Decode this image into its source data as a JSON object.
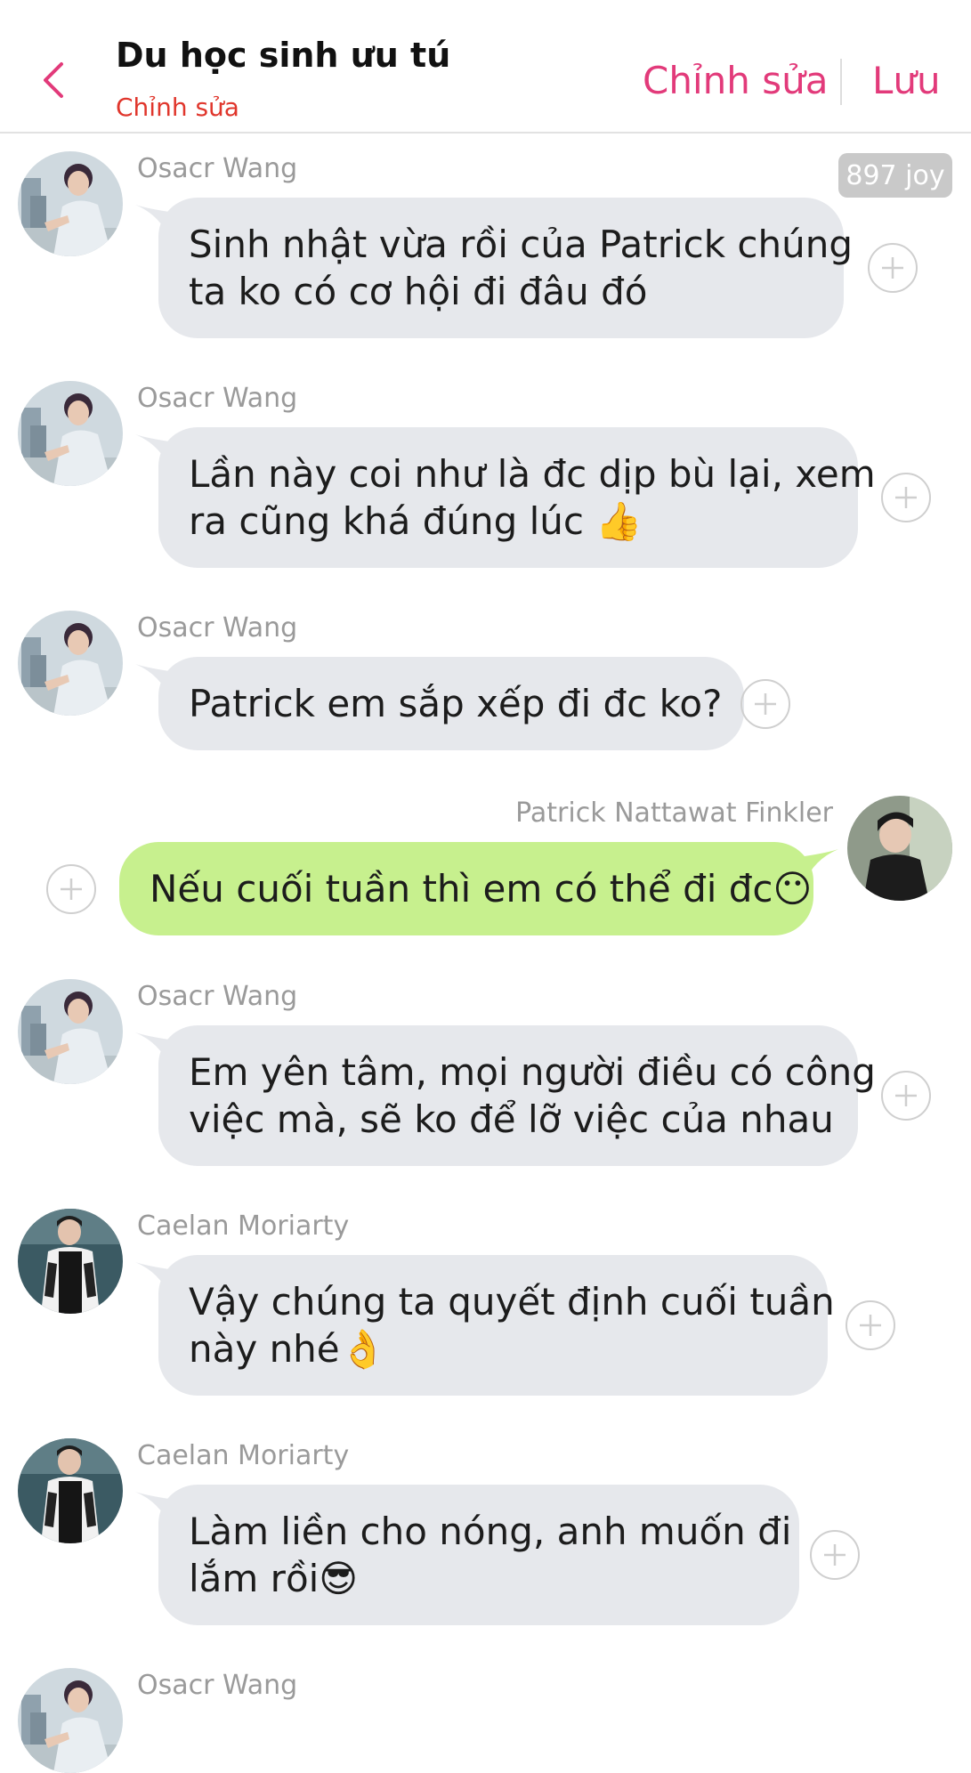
{
  "header": {
    "title": "Du học sinh ưu tú",
    "subtitle": "Chỉnh sửa",
    "edit_label": "Chỉnh sửa",
    "save_label": "Lưu",
    "accent_color": "#e23a7a",
    "back_icon": "chevron-left-icon"
  },
  "badge": {
    "text": "897 joy"
  },
  "messages": [
    {
      "sender": "Osacr Wang",
      "lines": [
        "Sinh nhật vừa rồi của Patrick chúng",
        "ta ko có cơ hội đi đâu đó"
      ],
      "direction": "incoming"
    },
    {
      "sender": "Osacr Wang",
      "lines": [
        "Lần này coi như là đc dịp bù lại, xem",
        "ra cũng khá đúng lúc 👍"
      ],
      "direction": "incoming"
    },
    {
      "sender": "Osacr Wang",
      "lines": [
        "Patrick em sắp xếp đi đc ko?"
      ],
      "direction": "incoming"
    },
    {
      "sender": "Patrick Nattawat Finkler",
      "lines": [
        "Nếu cuối tuần thì em có thể đi đc😶"
      ],
      "direction": "outgoing"
    },
    {
      "sender": "Osacr Wang",
      "lines": [
        "Em yên tâm, mọi người điều có công",
        "việc mà, sẽ ko để lỡ việc của nhau"
      ],
      "direction": "incoming"
    },
    {
      "sender": "Caelan Moriarty",
      "lines": [
        "Vậy chúng ta quyết định cuối tuần",
        "này nhé👌"
      ],
      "direction": "incoming"
    },
    {
      "sender": "Caelan Moriarty",
      "lines": [
        "Làm liền cho nóng, anh muốn đi",
        "lắm rồi😎"
      ],
      "direction": "incoming"
    },
    {
      "sender": "Osacr Wang",
      "lines": [],
      "direction": "incoming"
    }
  ],
  "colors": {
    "incoming_bubble": "#e6e8ec",
    "outgoing_bubble": "#c7f08e",
    "subtitle": "#e0362c"
  },
  "icons": {
    "add": "plus-circle-icon",
    "avatar": "avatar"
  }
}
